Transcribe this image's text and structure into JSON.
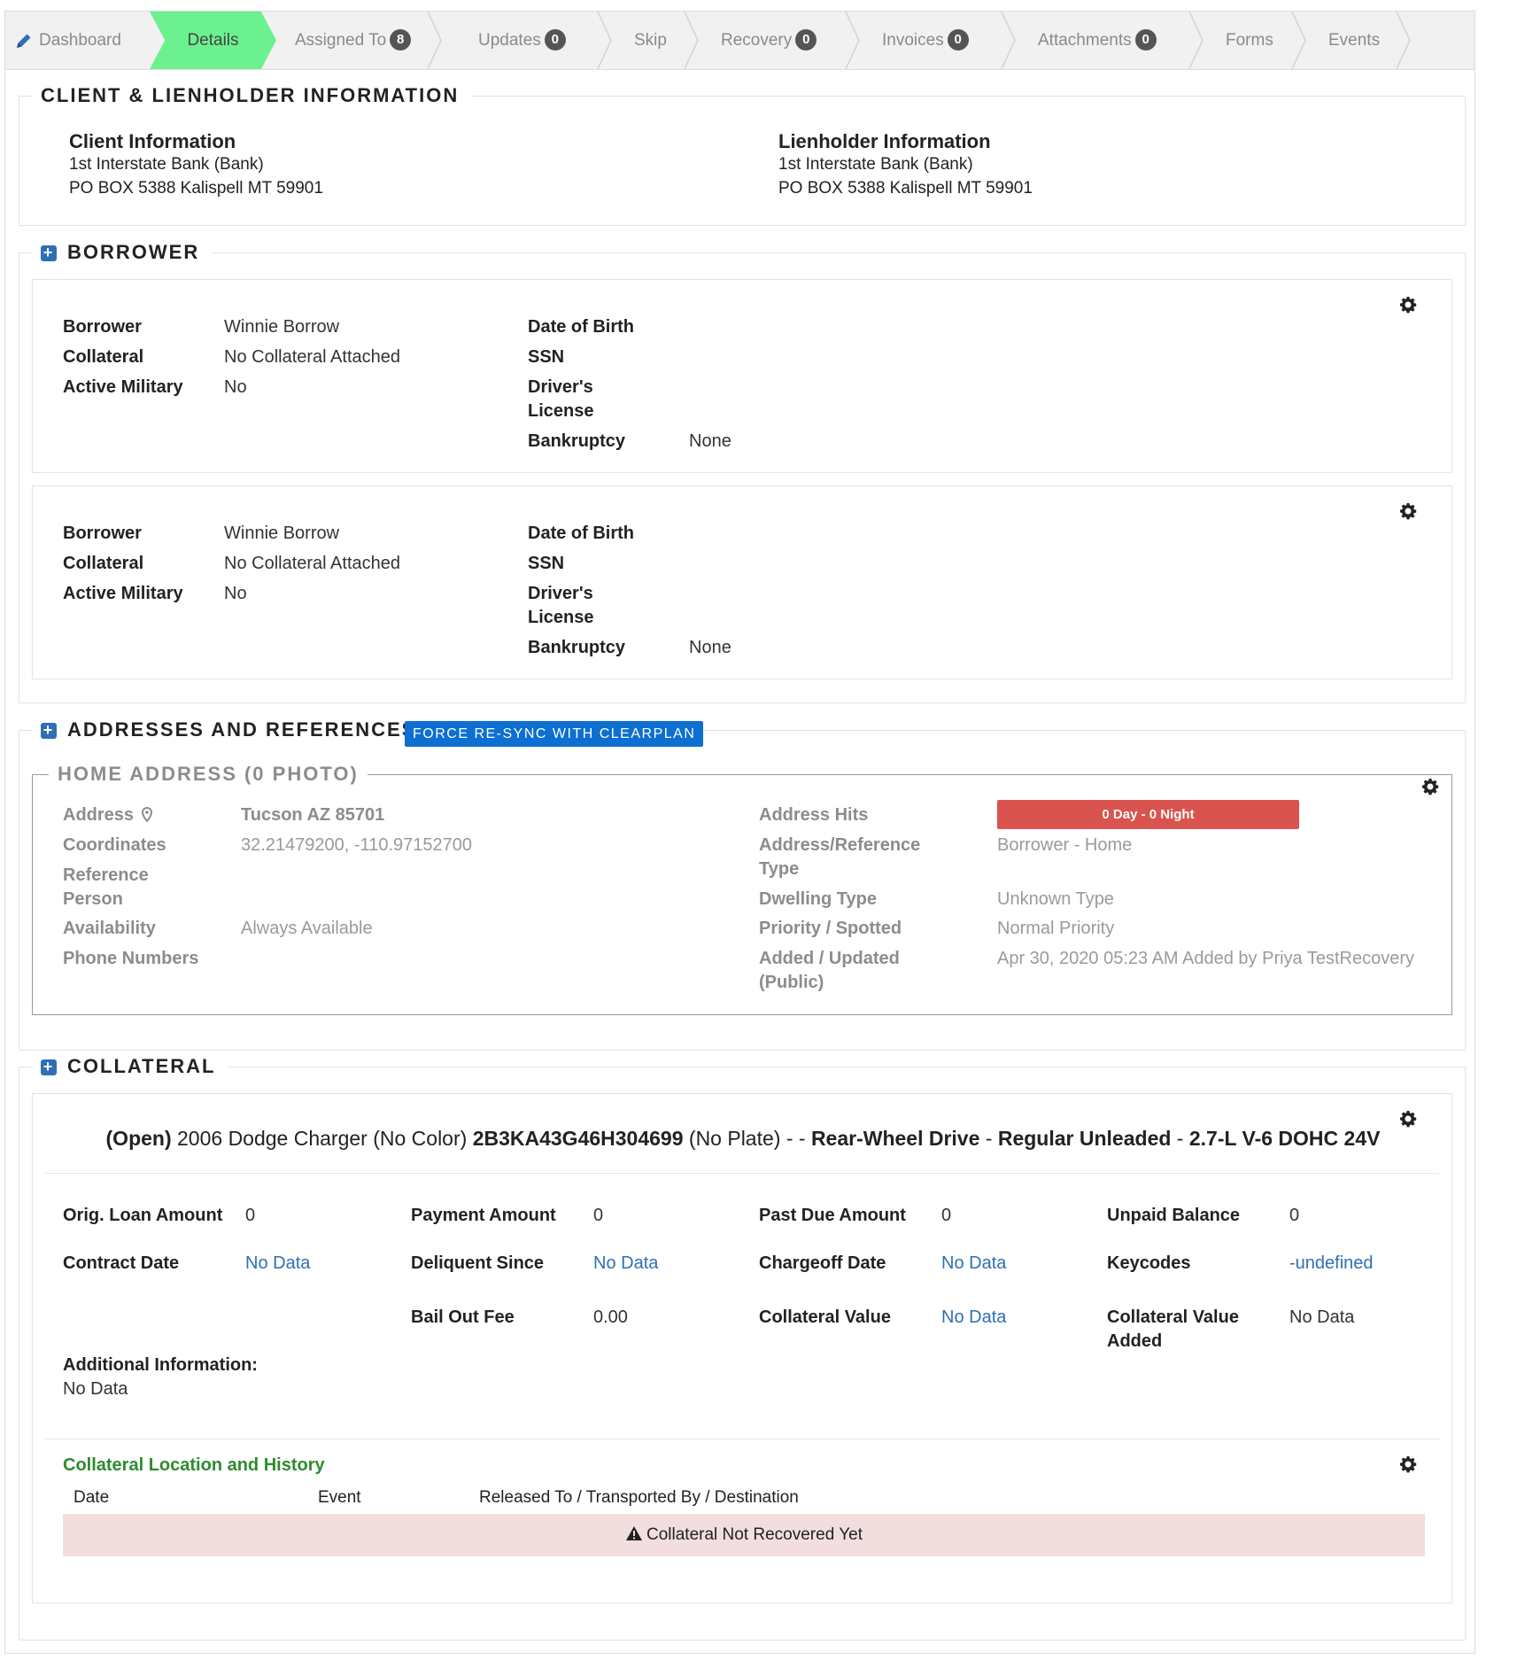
{
  "nav": {
    "tabs": [
      {
        "label": "Dashboard"
      },
      {
        "label": "Details",
        "active": true
      },
      {
        "label": "Assigned To",
        "badge": "8"
      },
      {
        "label": "Updates",
        "badge": "0"
      },
      {
        "label": "Skip"
      },
      {
        "label": "Recovery",
        "badge": "0"
      },
      {
        "label": "Invoices",
        "badge": "0"
      },
      {
        "label": "Attachments",
        "badge": "0"
      },
      {
        "label": "Forms"
      },
      {
        "label": "Events"
      }
    ]
  },
  "client_section": {
    "title": "CLIENT & LIENHOLDER INFORMATION",
    "client": {
      "heading": "Client Information",
      "name": "1st Interstate Bank (Bank)",
      "address": "PO BOX 5388 Kalispell MT 59901"
    },
    "lienholder": {
      "heading": "Lienholder Information",
      "name": "1st Interstate Bank (Bank)",
      "address": "PO BOX 5388 Kalispell MT 59901"
    }
  },
  "borrower_section": {
    "title": "BORROWER",
    "labels": {
      "borrower": "Borrower",
      "collateral": "Collateral",
      "active_military": "Active Military",
      "dob": "Date of Birth",
      "ssn": "SSN",
      "drivers_license_1": "Driver's",
      "drivers_license_2": "License",
      "bankruptcy": "Bankruptcy"
    },
    "cards": [
      {
        "borrower": "Winnie Borrow",
        "collateral": "No Collateral Attached",
        "active_military": "No",
        "bankruptcy": "None"
      },
      {
        "borrower": "Winnie Borrow",
        "collateral": "No Collateral Attached",
        "active_military": "No",
        "bankruptcy": "None"
      }
    ]
  },
  "addresses_section": {
    "title": "ADDRESSES AND REFERENCES",
    "resync_button": "FORCE RE-SYNC WITH CLEARPLAN",
    "home": {
      "title": "HOME ADDRESS (0 PHOTO)",
      "address_label": "Address",
      "address_value": "Tucson AZ 85701",
      "coordinates_label": "Coordinates",
      "coordinates_value": "32.21479200, -110.97152700",
      "reference_label_1": "Reference",
      "reference_label_2": "Person",
      "availability_label": "Availability",
      "availability_value": "Always Available",
      "phone_label": "Phone Numbers",
      "hits_label": "Address Hits",
      "hits_value": "0 Day - 0 Night",
      "type_label_1": "Address/Reference",
      "type_label_2": "Type",
      "type_value": "Borrower - Home",
      "dwelling_label": "Dwelling Type",
      "dwelling_value": "Unknown Type",
      "priority_label": "Priority / Spotted",
      "priority_value": "Normal Priority",
      "added_label_1": "Added / Updated",
      "added_label_2": "(Public)",
      "added_value": "Apr 30, 2020 05:23 AM Added by Priya TestRecovery"
    }
  },
  "collateral_section": {
    "title": "COLLATERAL",
    "summary": {
      "status": "(Open)",
      "vehicle": "2006 Dodge Charger (No Color)",
      "vin": "2B3KA43G46H304699",
      "plate": "(No Plate) - -",
      "drive": "Rear-Wheel Drive",
      "sep": "-",
      "fuel": "Regular Unleaded",
      "engine": "2.7-L V-6 DOHC 24V"
    },
    "fields": {
      "orig_loan_label": "Orig. Loan Amount",
      "orig_loan_value": "0",
      "payment_label": "Payment Amount",
      "payment_value": "0",
      "past_due_label": "Past Due Amount",
      "past_due_value": "0",
      "unpaid_label": "Unpaid Balance",
      "unpaid_value": "0",
      "contract_label": "Contract Date",
      "contract_value": "No Data",
      "delinquent_label": "Deliquent Since",
      "delinquent_value": "No Data",
      "chargeoff_label": "Chargeoff Date",
      "chargeoff_value": "No Data",
      "keycodes_label": "Keycodes",
      "keycodes_value": "-undefined",
      "bailout_label": "Bail Out Fee",
      "bailout_value": "0.00",
      "coll_value_label": "Collateral Value",
      "coll_value_value": "No Data",
      "coll_added_label_1": "Collateral Value",
      "coll_added_label_2": "Added",
      "coll_added_value": "No Data",
      "additional_label": "Additional Information:",
      "additional_value": "No Data"
    },
    "history": {
      "title": "Collateral Location and History",
      "col_date": "Date",
      "col_event": "Event",
      "col_dest": "Released To / Transported By / Destination",
      "empty_message": "Collateral Not Recovered Yet"
    }
  },
  "colors": {
    "active_tab": "#6cf191",
    "link": "#2f6fb5",
    "hits_badge": "#d9534f",
    "resync_button": "#0d6fd1",
    "history_title": "#2e8b2e",
    "empty_row": "#f2dede"
  }
}
